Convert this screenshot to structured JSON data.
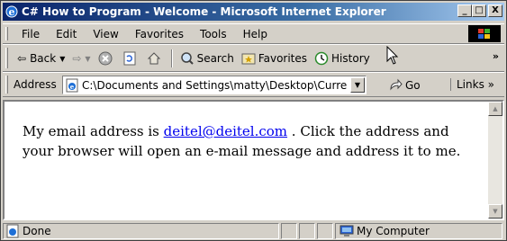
{
  "window": {
    "title": "C# How to Program - Welcome - Microsoft Internet Explorer",
    "minimize": "_",
    "maximize": "□",
    "close": "X"
  },
  "menu": {
    "items": [
      "File",
      "Edit",
      "View",
      "Favorites",
      "Tools",
      "Help"
    ]
  },
  "toolbar": {
    "back": "Back",
    "search": "Search",
    "favorites": "Favorites",
    "history": "History",
    "more": "»"
  },
  "address": {
    "label": "Address",
    "value": "C:\\Documents and Settings\\matty\\Desktop\\Curre",
    "go": "Go",
    "links": "Links »"
  },
  "content": {
    "text_before": "My email address is ",
    "email": "deitel@deitel.com",
    "text_after": " . Click the address and your browser will open an e-mail message and address it to me."
  },
  "status": {
    "text": "Done",
    "zone": "My Computer"
  },
  "colors": {
    "title_gradient_start": "#0a246a",
    "title_gradient_end": "#a6caf0",
    "link": "#0000ee",
    "chrome": "#d4d0c8"
  }
}
